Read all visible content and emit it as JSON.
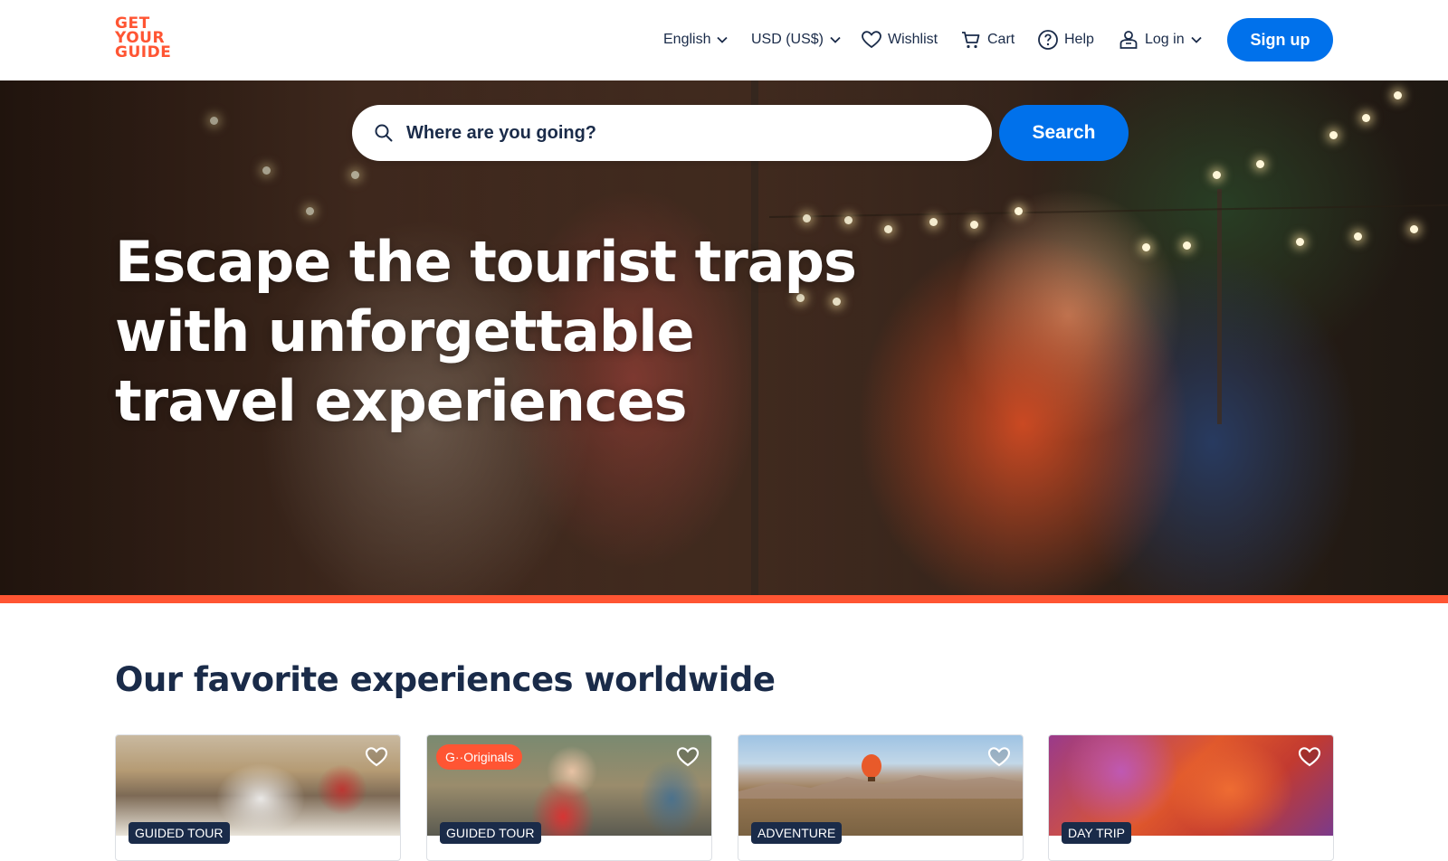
{
  "brand": {
    "logo_lines": [
      "GET",
      "YOUR",
      "GUIDE"
    ],
    "accent_color": "#ff5533",
    "primary_color": "#0071eb",
    "text_color": "#1a2b49"
  },
  "nav": {
    "language": "English",
    "currency": "USD (US$)",
    "wishlist": "Wishlist",
    "cart": "Cart",
    "help": "Help",
    "login": "Log in",
    "signup": "Sign up"
  },
  "hero": {
    "search_placeholder": "Where are you going?",
    "search_button": "Search",
    "headline": "Escape the tourist traps with unforgettable travel experiences"
  },
  "section": {
    "title": "Our favorite experiences worldwide"
  },
  "cards": [
    {
      "badge": "GUIDED TOUR",
      "originals": ""
    },
    {
      "badge": "GUIDED TOUR",
      "originals": "G··Originals"
    },
    {
      "badge": "ADVENTURE",
      "originals": ""
    },
    {
      "badge": "DAY TRIP",
      "originals": ""
    }
  ],
  "icons": {
    "chevron": "chevron-down-icon",
    "wishlist": "heart-icon",
    "cart": "cart-icon",
    "help": "help-circle-icon",
    "login": "user-icon",
    "search": "search-icon"
  }
}
